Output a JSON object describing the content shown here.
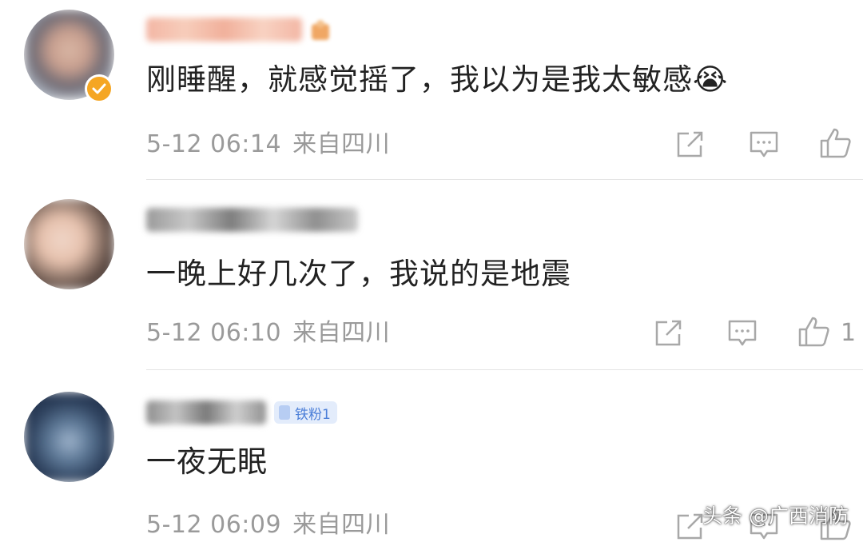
{
  "comments": [
    {
      "text": "刚睡醒，就感觉摇了，我以为是我太敏感😭",
      "date": "5-12 06:14",
      "location": "来自四川",
      "likes": "",
      "verified": true
    },
    {
      "text": "一晚上好几次了，我说的是地震",
      "date": "5-12 06:10",
      "location": "来自四川",
      "likes": "1",
      "verified": false
    },
    {
      "text": "一夜无眠",
      "date": "5-12 06:09",
      "location": "来自四川",
      "likes": "",
      "verified": false,
      "fan_badge": "铁粉1"
    }
  ],
  "icons": {
    "share": "share-icon",
    "comment": "comment-icon",
    "like": "thumbs-up-icon",
    "verified": "verified-badge-icon"
  },
  "colors": {
    "text": "#222222",
    "meta": "#9a9a9a",
    "fan_badge_bg": "#e3ecfb",
    "fan_badge_text": "#4c7fd8",
    "verified_badge": "#f5a623"
  },
  "watermark": "头条 @广西消防"
}
